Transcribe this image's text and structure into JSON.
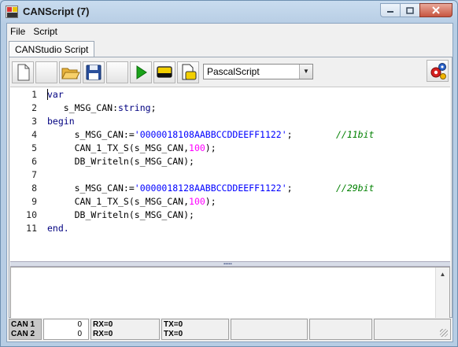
{
  "window": {
    "title": "CANScript (7)"
  },
  "menu": [
    "File",
    "Script"
  ],
  "tab": {
    "label": "CANStudio Script"
  },
  "toolbar": {
    "language": "PascalScript"
  },
  "editor": {
    "lines": [
      {
        "num": "1",
        "tokens": [
          {
            "t": "var",
            "c": "kw"
          }
        ]
      },
      {
        "num": "2",
        "tokens": [
          {
            "t": "   s_MSG_CAN:",
            "c": "id"
          },
          {
            "t": "string",
            "c": "kw"
          },
          {
            "t": ";",
            "c": "sym"
          }
        ]
      },
      {
        "num": "3",
        "tokens": [
          {
            "t": "begin",
            "c": "kw"
          }
        ]
      },
      {
        "num": "4",
        "tokens": [
          {
            "t": "     s_MSG_CAN:=",
            "c": "id"
          },
          {
            "t": "'0000018108AABBCCDDEEFF1122'",
            "c": "str"
          },
          {
            "t": ";        ",
            "c": "sym"
          },
          {
            "t": "//11bit",
            "c": "cm"
          }
        ]
      },
      {
        "num": "5",
        "tokens": [
          {
            "t": "     CAN_1_TX_S(s_MSG_CAN,",
            "c": "id"
          },
          {
            "t": "100",
            "c": "num"
          },
          {
            "t": ");",
            "c": "sym"
          }
        ]
      },
      {
        "num": "6",
        "tokens": [
          {
            "t": "     DB_Writeln(s_MSG_CAN);",
            "c": "id"
          }
        ]
      },
      {
        "num": "7",
        "tokens": []
      },
      {
        "num": "8",
        "tokens": [
          {
            "t": "     s_MSG_CAN:=",
            "c": "id"
          },
          {
            "t": "'0000018128AABBCCDDEEFF1122'",
            "c": "str"
          },
          {
            "t": ";        ",
            "c": "sym"
          },
          {
            "t": "//29bit",
            "c": "cm"
          }
        ]
      },
      {
        "num": "9",
        "tokens": [
          {
            "t": "     CAN_1_TX_S(s_MSG_CAN,",
            "c": "id"
          },
          {
            "t": "100",
            "c": "num"
          },
          {
            "t": ");",
            "c": "sym"
          }
        ]
      },
      {
        "num": "10",
        "tokens": [
          {
            "t": "     DB_Writeln(s_MSG_CAN);",
            "c": "id"
          }
        ]
      },
      {
        "num": "11",
        "tokens": [
          {
            "t": "end.",
            "c": "kw"
          }
        ]
      }
    ]
  },
  "status": {
    "labels": [
      "CAN 1",
      "CAN 2"
    ],
    "counts": [
      "0",
      "0"
    ],
    "rx": [
      "RX=0",
      "RX=0"
    ],
    "tx": [
      "TX=0",
      "TX=0"
    ]
  },
  "colors": {
    "keyword": "#000080",
    "string": "#0000ff",
    "number": "#ff00ff",
    "comment": "#008000"
  }
}
